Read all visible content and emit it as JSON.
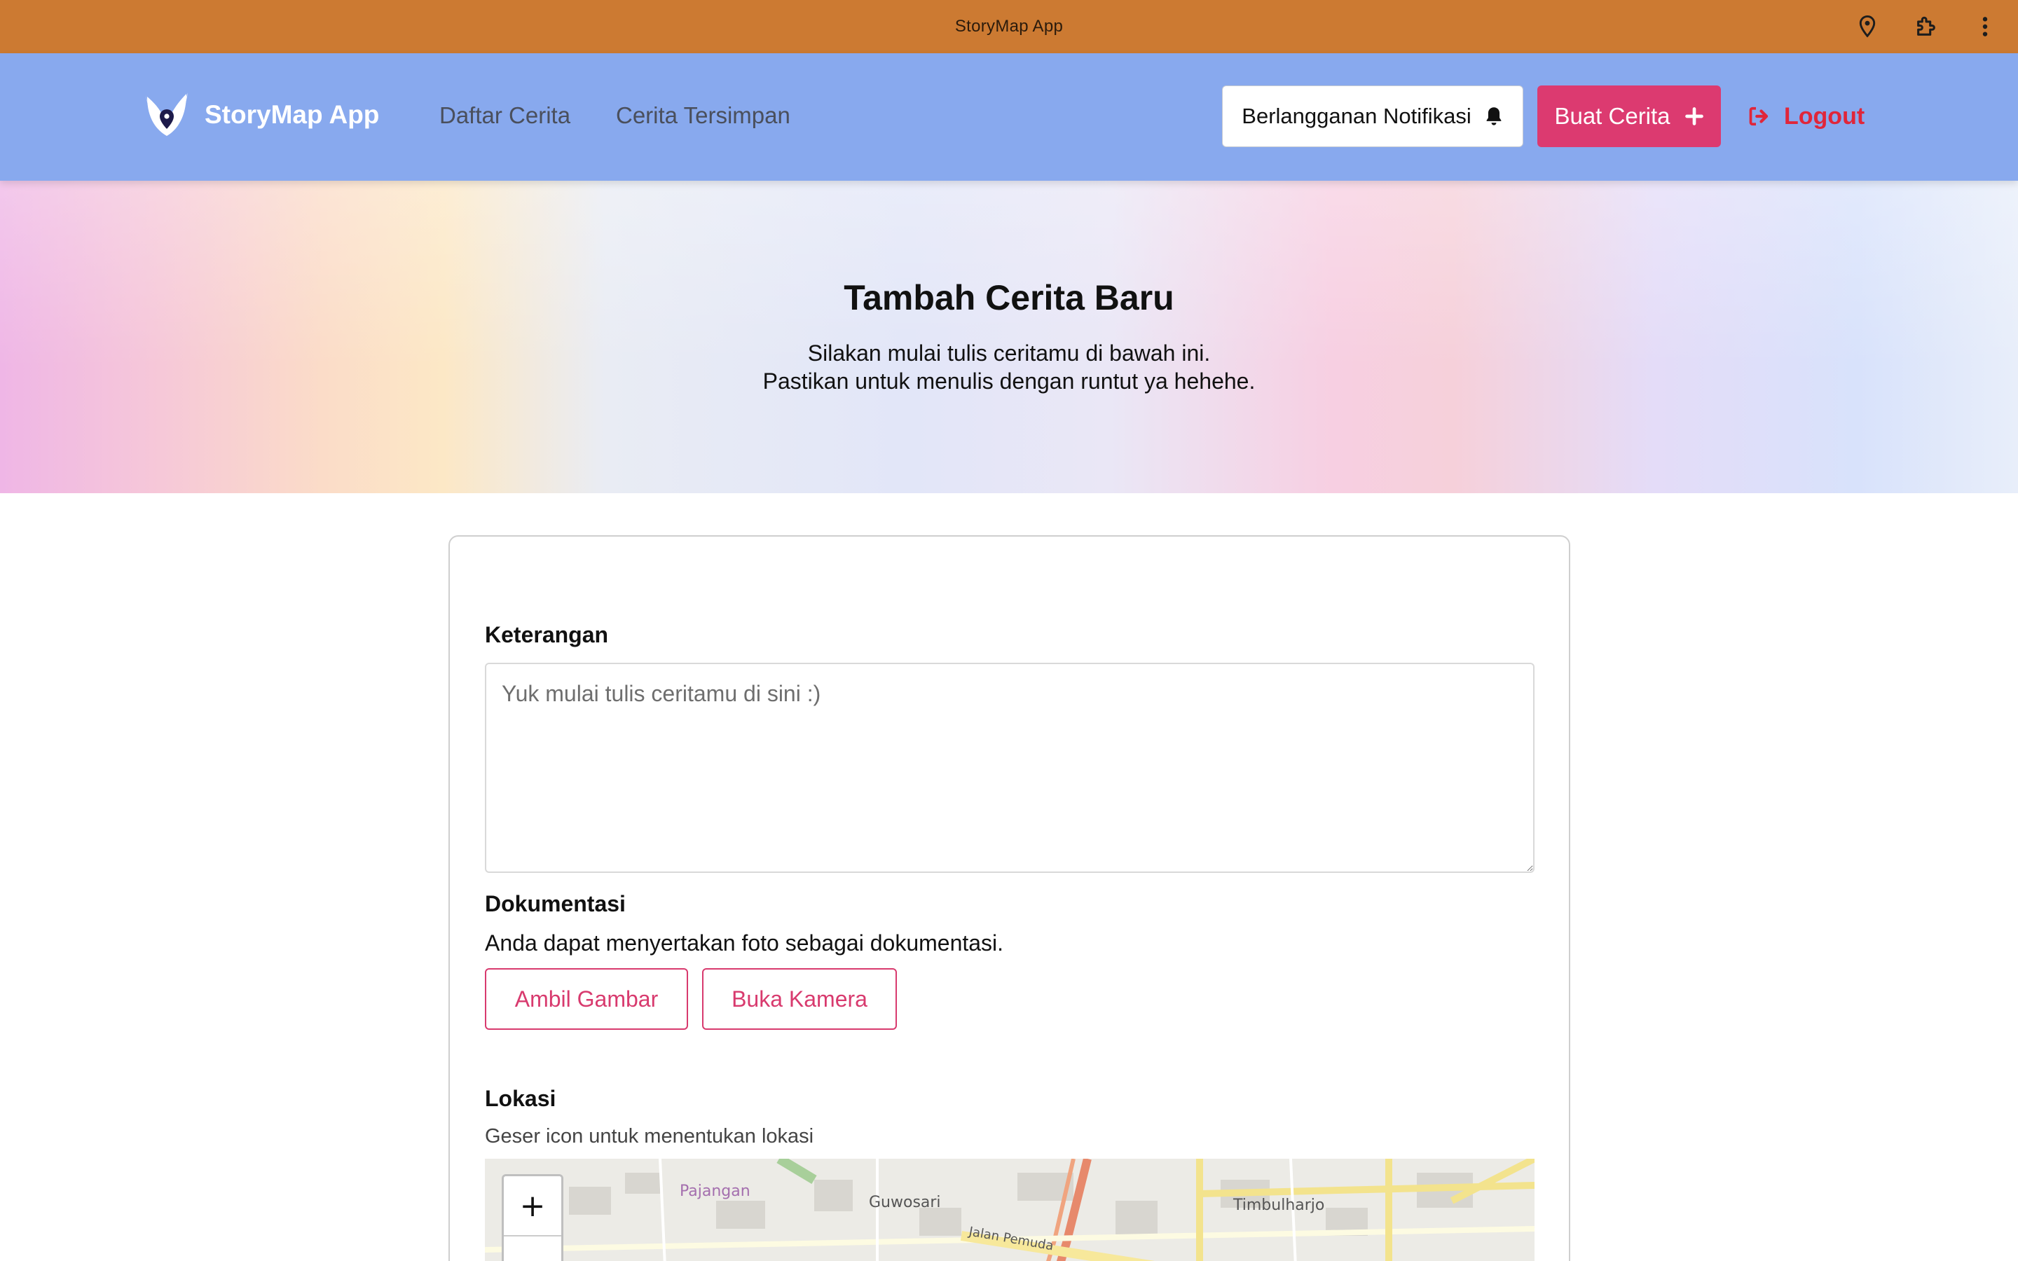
{
  "window": {
    "title": "StoryMap App"
  },
  "icons": {
    "location": "location-pin-icon",
    "extensions": "puzzle-icon",
    "menu": "kebab-menu-icon",
    "bell": "bell-icon",
    "plus": "plus-icon",
    "logout": "logout-icon"
  },
  "colors": {
    "titlebar": "#cc7a32",
    "navbar": "#88a9ee",
    "accent": "#dc3a70",
    "logout": "#e0263a"
  },
  "nav": {
    "brand": "StoryMap App",
    "links": [
      "Daftar Cerita",
      "Cerita Tersimpan"
    ],
    "subscribe_label": "Berlangganan Notifikasi",
    "create_label": "Buat Cerita",
    "logout_label": "Logout"
  },
  "hero": {
    "title": "Tambah Cerita Baru",
    "subtitle_line1": "Silakan mulai tulis ceritamu di bawah ini.",
    "subtitle_line2": "Pastikan untuk menulis dengan runtut ya hehehe."
  },
  "form": {
    "description_label": "Keterangan",
    "description_placeholder": "Yuk mulai tulis ceritamu di sini :)",
    "documentation_label": "Dokumentasi",
    "documentation_help": "Anda dapat menyertakan foto sebagai dokumentasi.",
    "take_picture_label": "Ambil Gambar",
    "open_camera_label": "Buka Kamera",
    "location_label": "Lokasi",
    "location_help": "Geser icon untuk menentukan lokasi"
  },
  "map": {
    "zoom_in": "+",
    "zoom_out": "−",
    "place_labels": [
      "Pajangan",
      "Guwosari",
      "Timbulharjo",
      "Jalan Pemuda"
    ]
  }
}
